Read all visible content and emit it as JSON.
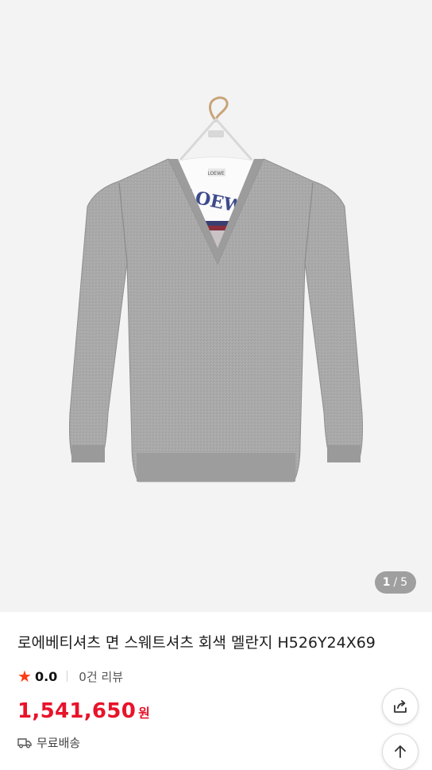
{
  "gallery": {
    "current_page": "1",
    "separator": "/",
    "total_pages": "5"
  },
  "product": {
    "title": "로에베티셔츠 면 스웨트셔츠 회색 멜란지 H526Y24X69",
    "rating": "0.0",
    "review_count": "0건 리뷰",
    "price": "1,541,650",
    "currency": "원",
    "shipping": "무료배송"
  },
  "icons": {
    "rating": "star-icon",
    "shipping": "truck-icon",
    "share": "share-icon",
    "scroll_top": "arrow-up-icon"
  },
  "colors": {
    "price": "#e8132a",
    "star": "#ff3b14",
    "gallery_bg": "#f3f3f3"
  }
}
